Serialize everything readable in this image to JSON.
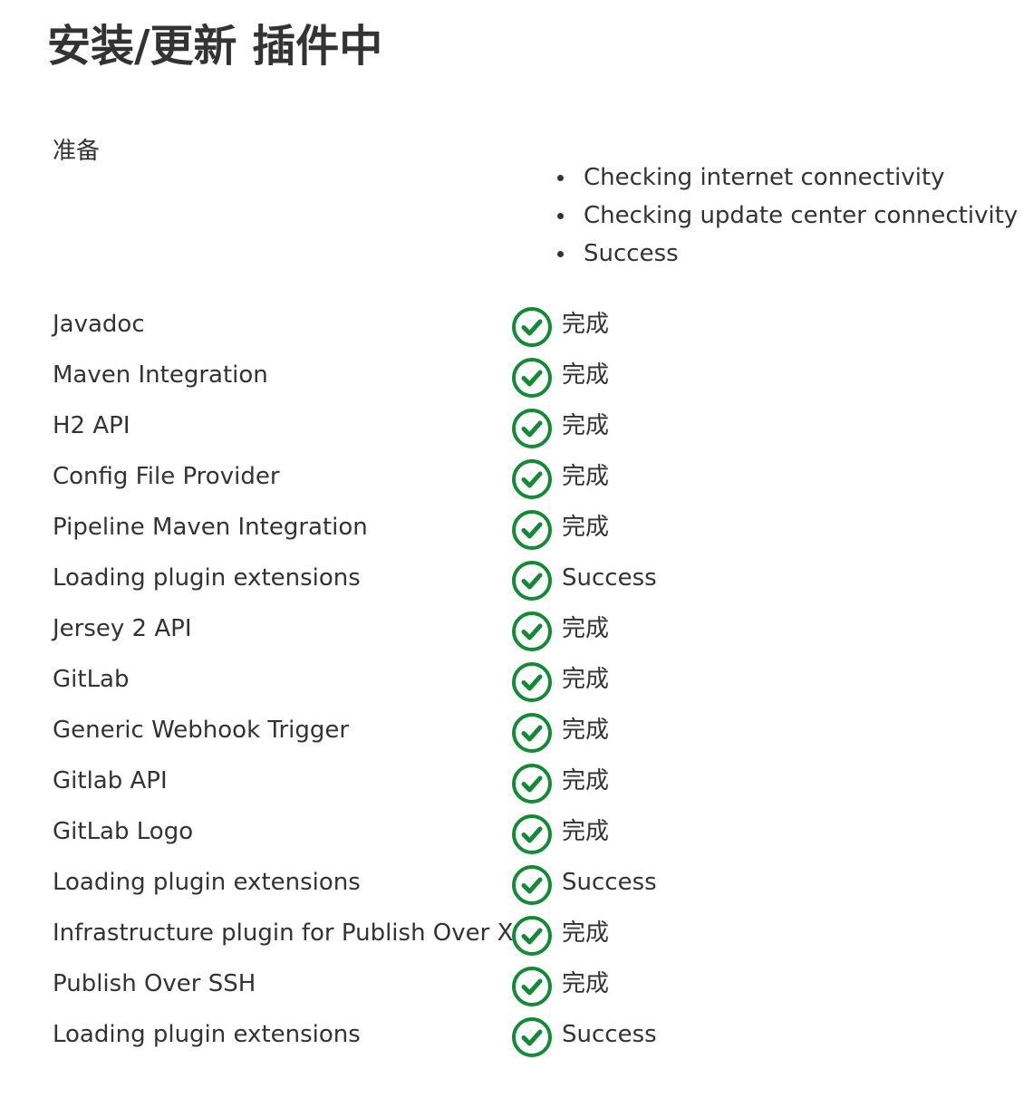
{
  "page": {
    "title": "安装/更新 插件中"
  },
  "preparation": {
    "label": "准备",
    "checks": [
      "Checking internet connectivity",
      "Checking update center connectivity",
      "Success"
    ]
  },
  "status_icon": {
    "name": "check-circle-icon",
    "color": "#138a36"
  },
  "plugins": [
    {
      "name": "Javadoc",
      "status": "完成"
    },
    {
      "name": "Maven Integration",
      "status": "完成"
    },
    {
      "name": "H2 API",
      "status": "完成"
    },
    {
      "name": "Config File Provider",
      "status": "完成"
    },
    {
      "name": "Pipeline Maven Integration",
      "status": "完成"
    },
    {
      "name": "Loading plugin extensions",
      "status": "Success"
    },
    {
      "name": "Jersey 2 API",
      "status": "完成"
    },
    {
      "name": "GitLab",
      "status": "完成"
    },
    {
      "name": "Generic Webhook Trigger",
      "status": "完成"
    },
    {
      "name": "Gitlab API",
      "status": "完成"
    },
    {
      "name": "GitLab Logo",
      "status": "完成"
    },
    {
      "name": "Loading plugin extensions",
      "status": "Success"
    },
    {
      "name": "Infrastructure plugin for Publish Over X",
      "status": "完成"
    },
    {
      "name": "Publish Over SSH",
      "status": "完成"
    },
    {
      "name": "Loading plugin extensions",
      "status": "Success"
    }
  ]
}
